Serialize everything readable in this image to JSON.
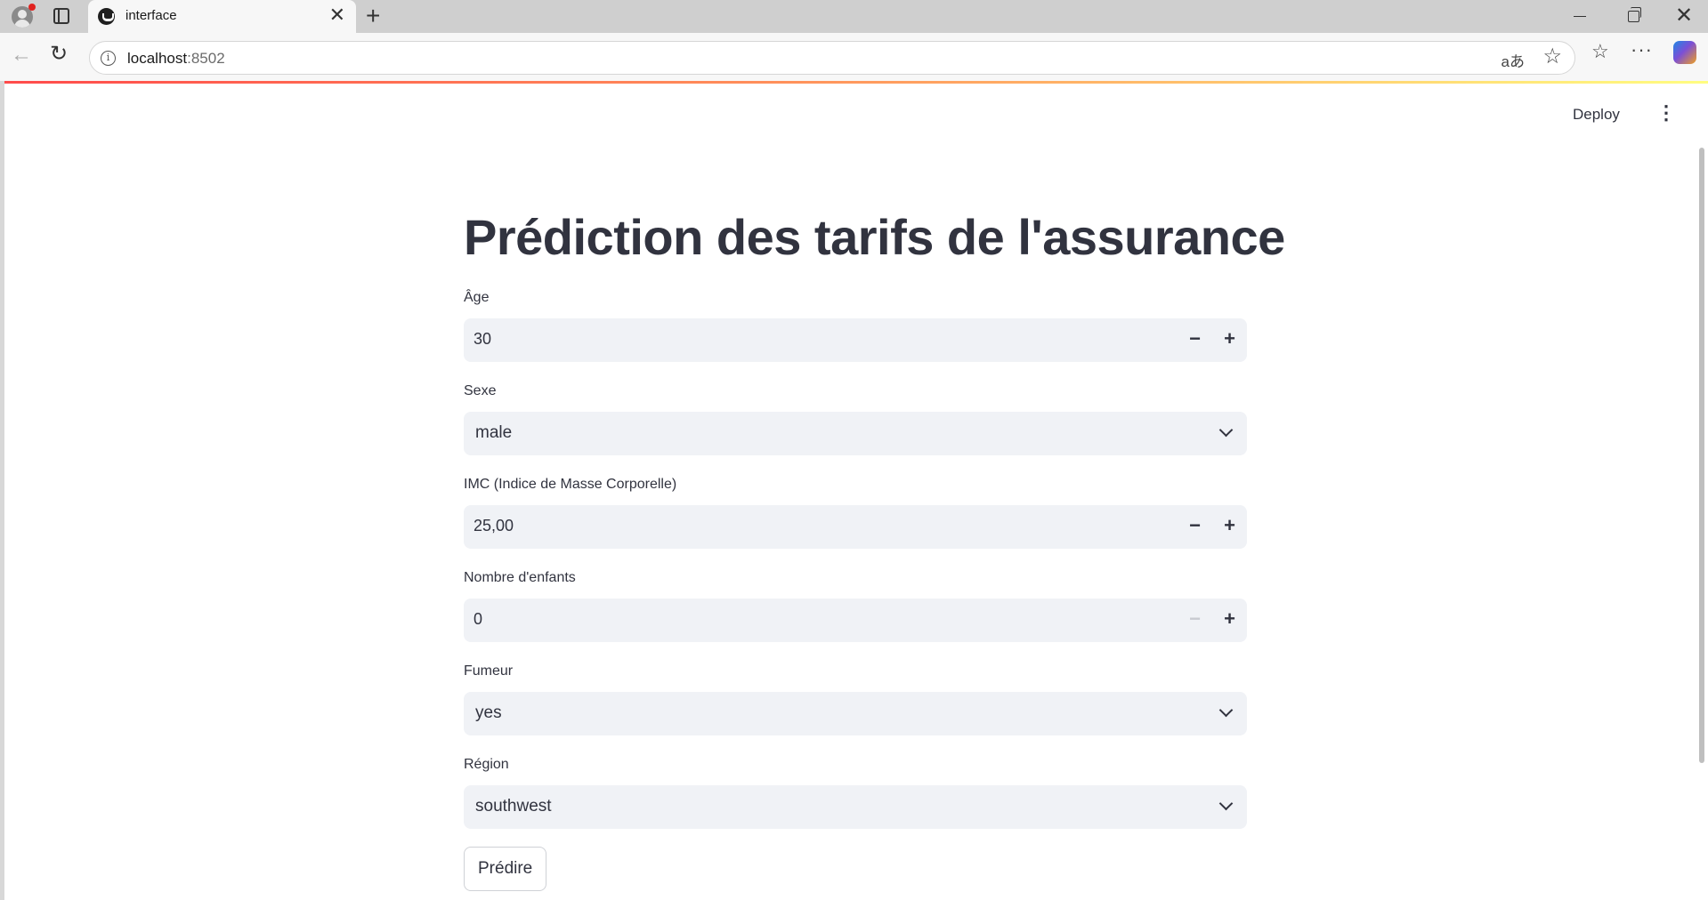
{
  "browser": {
    "tab_title": "interface",
    "url_host": "localhost",
    "url_port": ":8502",
    "read_aloud_glyph": "aあ"
  },
  "app": {
    "deploy_label": "Deploy",
    "title": "Prédiction des tarifs de l'assurance",
    "fields": {
      "age": {
        "label": "Âge",
        "value": "30"
      },
      "sex": {
        "label": "Sexe",
        "value": "male"
      },
      "bmi": {
        "label": "IMC (Indice de Masse Corporelle)",
        "value": "25,00"
      },
      "children": {
        "label": "Nombre d'enfants",
        "value": "0"
      },
      "smoker": {
        "label": "Fumeur",
        "value": "yes"
      },
      "region": {
        "label": "Région",
        "value": "southwest"
      }
    },
    "predict_button": "Prédire"
  },
  "colors": {
    "text": "#31333f",
    "input_bg": "#f0f2f6",
    "accent_gradient_start": "#ff4b4b",
    "accent_gradient_end": "#fffd80"
  },
  "icons": [
    "profile-icon",
    "tabs-icon",
    "favicon-icon",
    "close-icon",
    "plus-icon",
    "minimize-icon",
    "maximize-icon",
    "back-icon",
    "reload-icon",
    "info-icon",
    "read-aloud-icon",
    "star-icon",
    "favorites-icon",
    "more-icon",
    "copilot-icon",
    "kebab-menu-icon",
    "minus-icon",
    "chevron-down-icon"
  ]
}
